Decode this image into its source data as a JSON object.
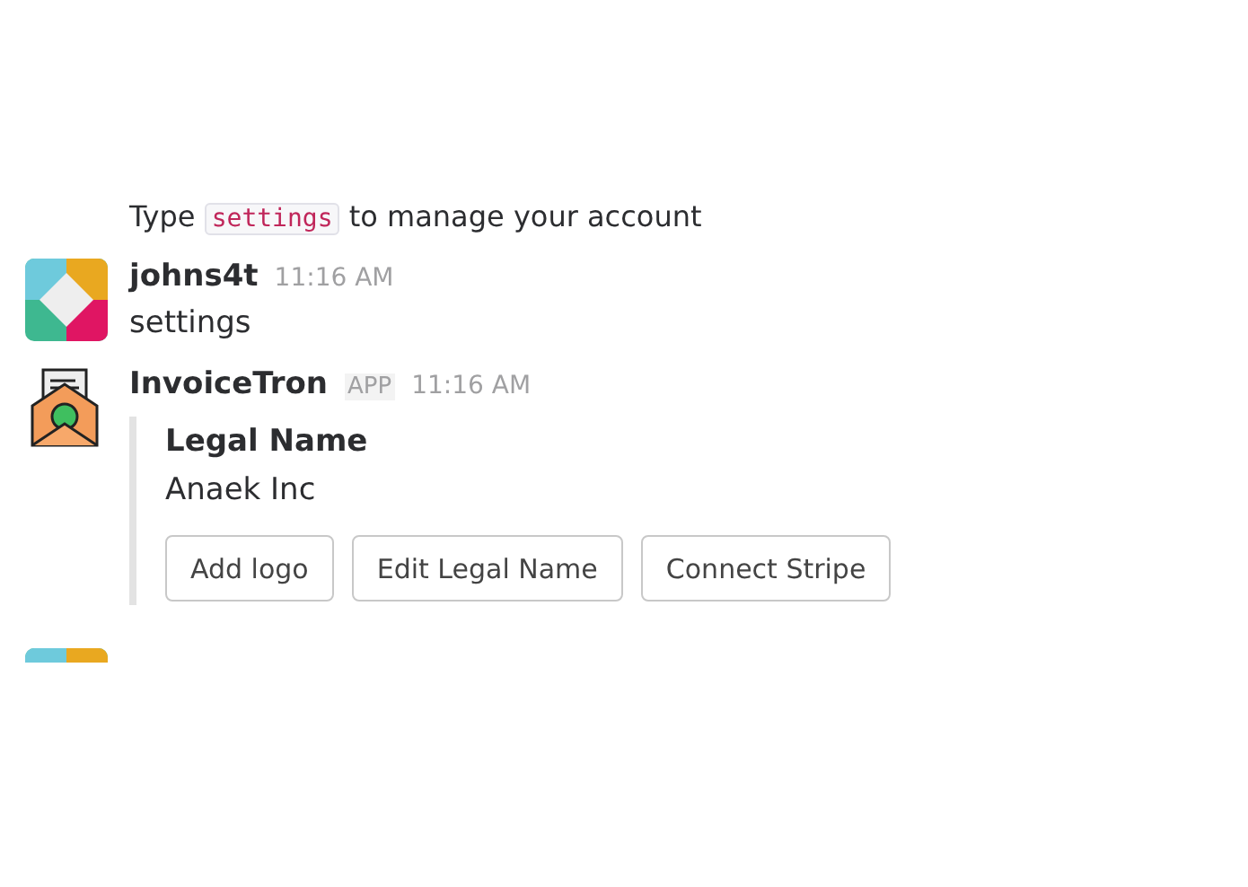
{
  "previous_message": {
    "before": "Type",
    "code": "settings",
    "after": "to manage your account"
  },
  "messages": [
    {
      "kind": "user",
      "author": "johns4t",
      "time": "11:16 AM",
      "text": "settings"
    },
    {
      "kind": "app",
      "author": "InvoiceTron",
      "badge": "APP",
      "time": "11:16 AM",
      "attachment": {
        "title": "Legal Name",
        "value": "Anaek Inc",
        "buttons": [
          "Add logo",
          "Edit Legal Name",
          "Connect Stripe"
        ]
      }
    }
  ],
  "next_message": {
    "kind": "user"
  }
}
